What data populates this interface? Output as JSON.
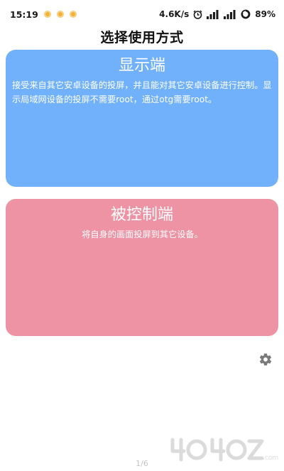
{
  "status_bar": {
    "time": "15:19",
    "net_speed": "4.6K/s",
    "signal_label_1": "5G",
    "signal_label_2": "HD",
    "battery_percent": "89%"
  },
  "page": {
    "title": "选择使用方式"
  },
  "cards": {
    "display": {
      "title": "显示端",
      "description": "接受来自其它安卓设备的投屏，并且能对其它安卓设备进行控制。显示局域网设备的投屏不需要root，通过otg需要root。",
      "color": "#71b1fb"
    },
    "controlled": {
      "title": "被控制端",
      "description": "将自身的画面投屏到其它设备。",
      "color": "#ee93a4"
    }
  },
  "settings": {
    "icon": "gear-icon"
  },
  "pager": {
    "text": "1/6"
  },
  "watermark": {
    "text": "4040Z.com"
  }
}
